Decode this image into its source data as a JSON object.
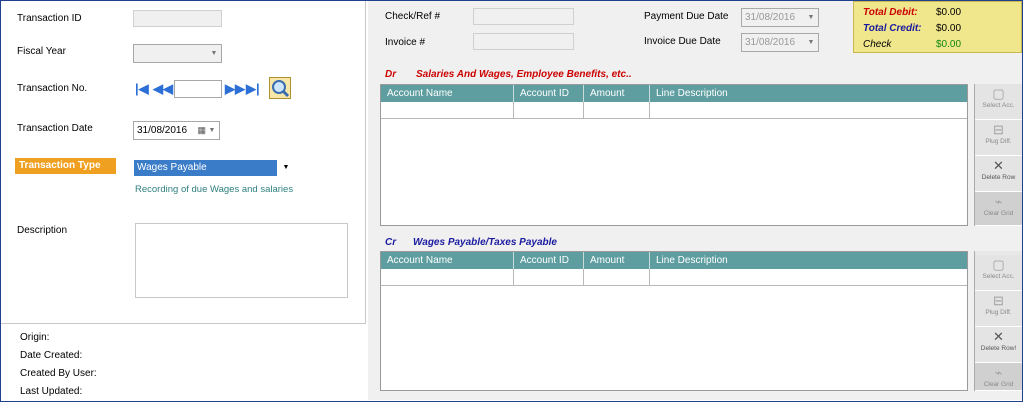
{
  "left": {
    "transaction_id_label": "Transaction ID",
    "transaction_id_value": "",
    "fiscal_year_label": "Fiscal Year",
    "fiscal_year_value": "",
    "transaction_no_label": "Transaction No.",
    "transaction_no_value": "",
    "transaction_date_label": "Transaction Date",
    "transaction_date_value": "31/08/2016",
    "transaction_type_label": "Transaction Type",
    "transaction_type_value": "Wages Payable",
    "transaction_type_hint": "Recording of due Wages and salaries",
    "description_label": "Description",
    "description_value": "",
    "nav": {
      "first": "|◀",
      "prev": "◀◀",
      "next": "▶▶",
      "last": "▶|"
    }
  },
  "meta": {
    "origin": "Origin:",
    "date_created": "Date Created:",
    "created_by": "Created By User:",
    "last_updated": "Last Updated:"
  },
  "header": {
    "check_ref_label": "Check/Ref #",
    "check_ref_value": "",
    "invoice_label": "Invoice #",
    "invoice_value": "",
    "payment_due_label": "Payment Due Date",
    "payment_due_value": "31/08/2016",
    "invoice_due_label": "Invoice Due Date",
    "invoice_due_value": "31/08/2016"
  },
  "totals": {
    "debit_label": "Total Debit:",
    "debit_value": "$0.00",
    "credit_label": "Total Credit:",
    "credit_value": "$0.00",
    "check_label": "Check",
    "check_value": "$0.00",
    "colors": {
      "debit": "#cc0000",
      "credit": "#1a1aa0",
      "check_value": "#118811"
    }
  },
  "debit_section": {
    "prefix": "Dr",
    "title": "Salaries And Wages, Employee Benefits, etc..",
    "columns": [
      "Account Name",
      "Account ID",
      "Amount",
      "Line Description"
    ]
  },
  "credit_section": {
    "prefix": "Cr",
    "title": "Wages Payable/Taxes Payable",
    "columns": [
      "Account Name",
      "Account ID",
      "Amount",
      "Line Description"
    ]
  },
  "tools_top": [
    "Select Acc.",
    "Plug Diff.",
    "Delete Row",
    "Clear Grid"
  ],
  "tools_bottom": [
    "Select Acc.",
    "Plug Diff.",
    "Delete Row!",
    "Clear Grid"
  ],
  "colors": {
    "accent_orange": "#f0a020",
    "grid_header": "#5f9ea0",
    "selection": "#3a7cc8"
  }
}
